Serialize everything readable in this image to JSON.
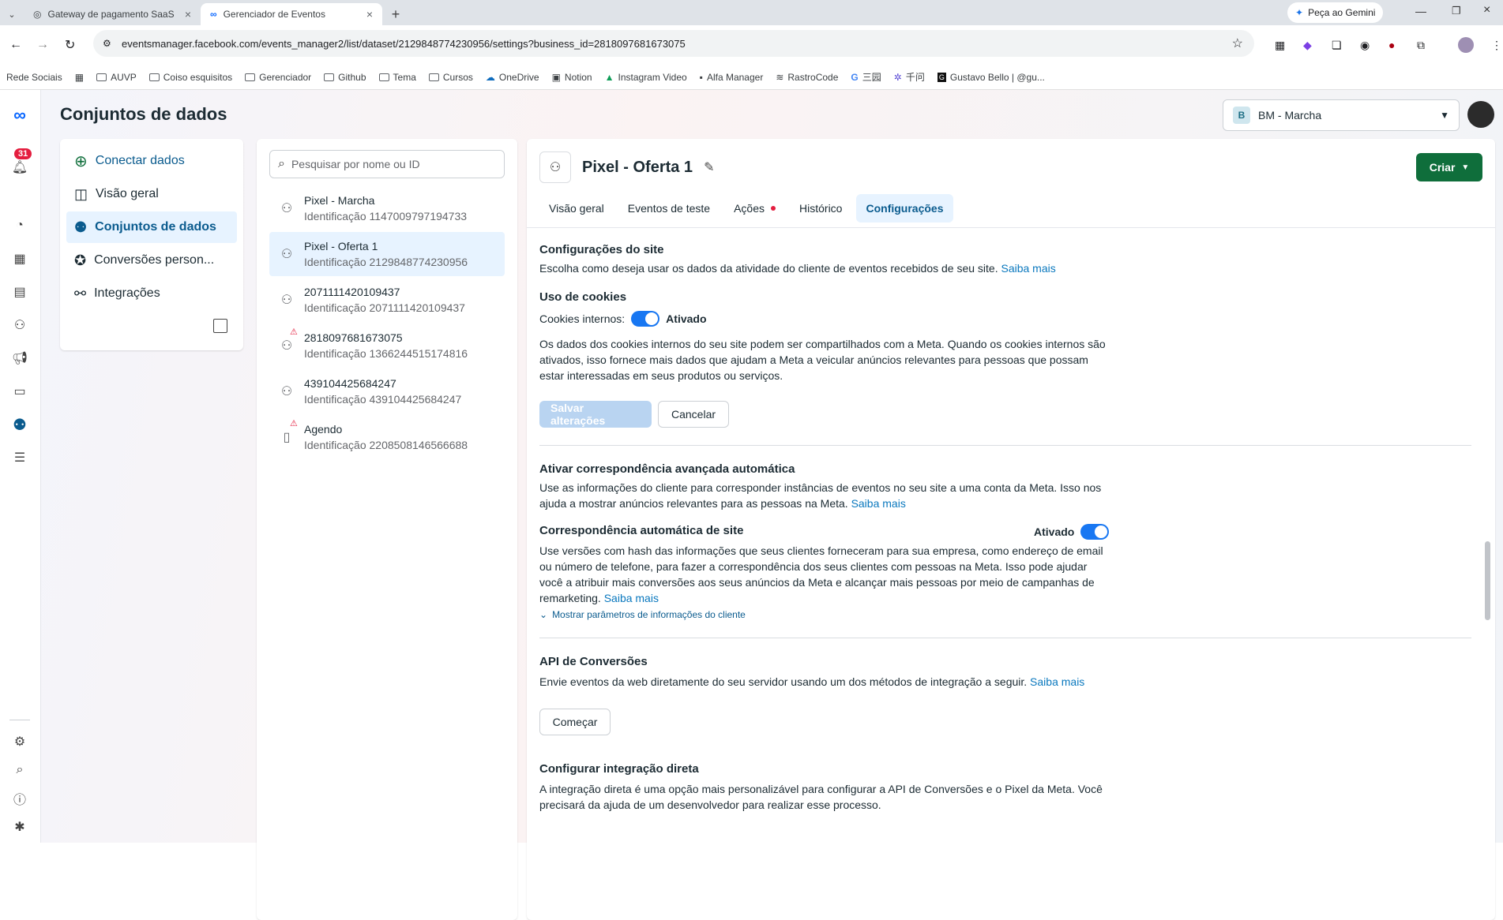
{
  "browser": {
    "tabs": [
      {
        "title": "Gateway de pagamento SaaS"
      },
      {
        "title": "Gerenciador de Eventos"
      }
    ],
    "gemini_label": "Peça ao Gemini",
    "url": "eventsmanager.facebook.com/events_manager2/list/dataset/2129848774230956/settings?business_id=2818097681673075",
    "bookmarks": [
      "Rede Sociais",
      "AUVP",
      "Coiso esquisitos",
      "Gerenciador",
      "Github",
      "Tema",
      "Cursos",
      "OneDrive",
      "Notion",
      "Instagram Video",
      "Alfa Manager",
      "RastroCode",
      "三园",
      "千问",
      "Gustavo Bello | @gu..."
    ]
  },
  "rail": {
    "notifications": "31"
  },
  "header": {
    "title": "Conjuntos de dados",
    "business": "BM - Marcha",
    "business_initial": "B"
  },
  "nav": {
    "items": [
      {
        "label": "Conectar dados"
      },
      {
        "label": "Visão geral"
      },
      {
        "label": "Conjuntos de dados"
      },
      {
        "label": "Conversões person..."
      },
      {
        "label": "Integrações"
      }
    ]
  },
  "datasets": {
    "search_placeholder": "Pesquisar por nome ou ID",
    "items": [
      {
        "name": "Pixel - Marcha",
        "id": "Identificação 1147009797194733"
      },
      {
        "name": "Pixel - Oferta 1",
        "id": "Identificação 2129848774230956"
      },
      {
        "name": "2071111420109437",
        "id": "Identificação 2071111420109437"
      },
      {
        "name": "2818097681673075",
        "id": "Identificação 1366244515174816"
      },
      {
        "name": "439104425684247",
        "id": "Identificação 439104425684247"
      },
      {
        "name": "Agendo",
        "id": "Identificação 2208508146566688"
      }
    ]
  },
  "main": {
    "pixel_name": "Pixel - Oferta 1",
    "create_label": "Criar",
    "tabs": [
      {
        "label": "Visão geral"
      },
      {
        "label": "Eventos de teste"
      },
      {
        "label": "Ações"
      },
      {
        "label": "Histórico"
      },
      {
        "label": "Configurações"
      }
    ],
    "site_settings": {
      "title": "Configurações do site",
      "desc": "Escolha como deseja usar os dados da atividade do cliente de eventos recebidos de seu site.",
      "learn_more": "Saiba mais"
    },
    "cookies": {
      "title": "Uso de cookies",
      "label": "Cookies internos:",
      "state": "Ativado",
      "desc": "Os dados dos cookies internos do seu site podem ser compartilhados com a Meta. Quando os cookies internos são ativados, isso fornece mais dados que ajudam a Meta a veicular anúncios relevantes para pessoas que possam estar interessadas em seus produtos ou serviços.",
      "save_label": "Salvar alterações",
      "cancel_label": "Cancelar"
    },
    "advanced_matching": {
      "title": "Ativar correspondência avançada automática",
      "desc": "Use as informações do cliente para corresponder instâncias de eventos no seu site a uma conta da Meta. Isso nos ajuda a mostrar anúncios relevantes para as pessoas na Meta.",
      "learn_more": "Saiba mais"
    },
    "auto_match": {
      "title": "Correspondência automática de site",
      "state": "Ativado",
      "desc": "Use versões com hash das informações que seus clientes forneceram para sua empresa, como endereço de email ou número de telefone, para fazer a correspondência dos seus clientes com pessoas na Meta. Isso pode ajudar você a atribuir mais conversões aos seus anúncios da Meta e alcançar mais pessoas por meio de campanhas de remarketing.",
      "learn_more": "Saiba mais",
      "show_params": "Mostrar parâmetros de informações do cliente"
    },
    "capi": {
      "title": "API de Conversões",
      "desc": "Envie eventos da web diretamente do seu servidor usando um dos métodos de integração a seguir.",
      "learn_more": "Saiba mais",
      "start_label": "Começar"
    },
    "direct": {
      "title": "Configurar integração direta",
      "desc": "A integração direta é uma opção mais personalizável para configurar a API de Conversões e o Pixel da Meta. Você precisará da ajuda de um desenvolvedor para realizar esse processo."
    }
  }
}
